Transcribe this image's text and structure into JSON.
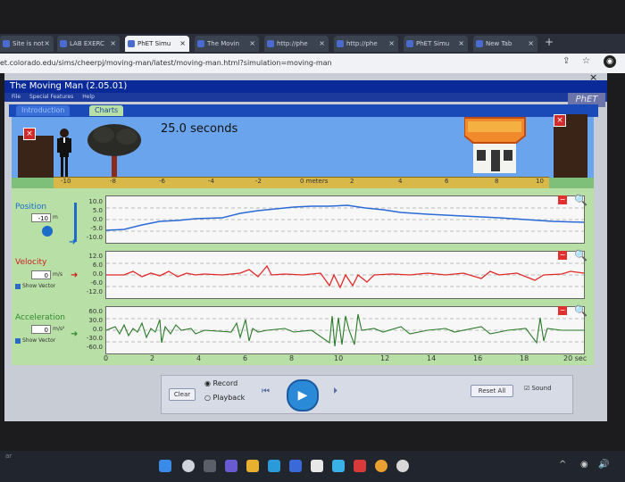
{
  "browser": {
    "tabs": [
      {
        "label": "Site is not"
      },
      {
        "label": "LAB EXERC"
      },
      {
        "label": "PhET Simu"
      },
      {
        "label": "The Movin"
      },
      {
        "label": "http://phe"
      },
      {
        "label": "http://phe"
      },
      {
        "label": "PhET Simu"
      },
      {
        "label": "New Tab"
      }
    ],
    "url": "et.colorado.edu/sims/cheerpj/moving-man/latest/moving-man.html?simulation=moving-man"
  },
  "app": {
    "title": "The Moving Man (2.05.01)",
    "menu": [
      "File",
      "Special Features",
      "Help"
    ],
    "logo": "PhET",
    "tabs": [
      "Introduction",
      "Charts"
    ],
    "timer": "25.0 seconds",
    "ruler": {
      "ticks": [
        "-10",
        "-8",
        "-6",
        "-4",
        "-2",
        "0 meters",
        "2",
        "4",
        "6",
        "8",
        "10"
      ]
    },
    "position": {
      "label": "Position",
      "value": "-10",
      "unit": "m",
      "yticks": [
        "10.0",
        "5.0",
        "0.0",
        "-5.0",
        "-10.0"
      ]
    },
    "velocity": {
      "label": "Velocity",
      "value": "0",
      "unit": "m/s",
      "show_vector": "Show Vector",
      "yticks": [
        "12.0",
        "6.0",
        "0.0",
        "-6.0",
        "-12.0"
      ]
    },
    "acceleration": {
      "label": "Acceleration",
      "value": "0",
      "unit": "m/s²",
      "show_vector": "Show Vector",
      "yticks": [
        "60.0",
        "30.0",
        "0.0",
        "-30.0",
        "-60.0"
      ]
    },
    "time_axis": [
      "0",
      "2",
      "4",
      "6",
      "8",
      "10",
      "12",
      "14",
      "16",
      "18",
      "20 sec"
    ],
    "controls": {
      "clear": "Clear",
      "record": "Record",
      "playback": "Playback",
      "reset_all": "Reset All",
      "sound": "Sound"
    }
  },
  "taskbar": {
    "left_label": "ar"
  }
}
